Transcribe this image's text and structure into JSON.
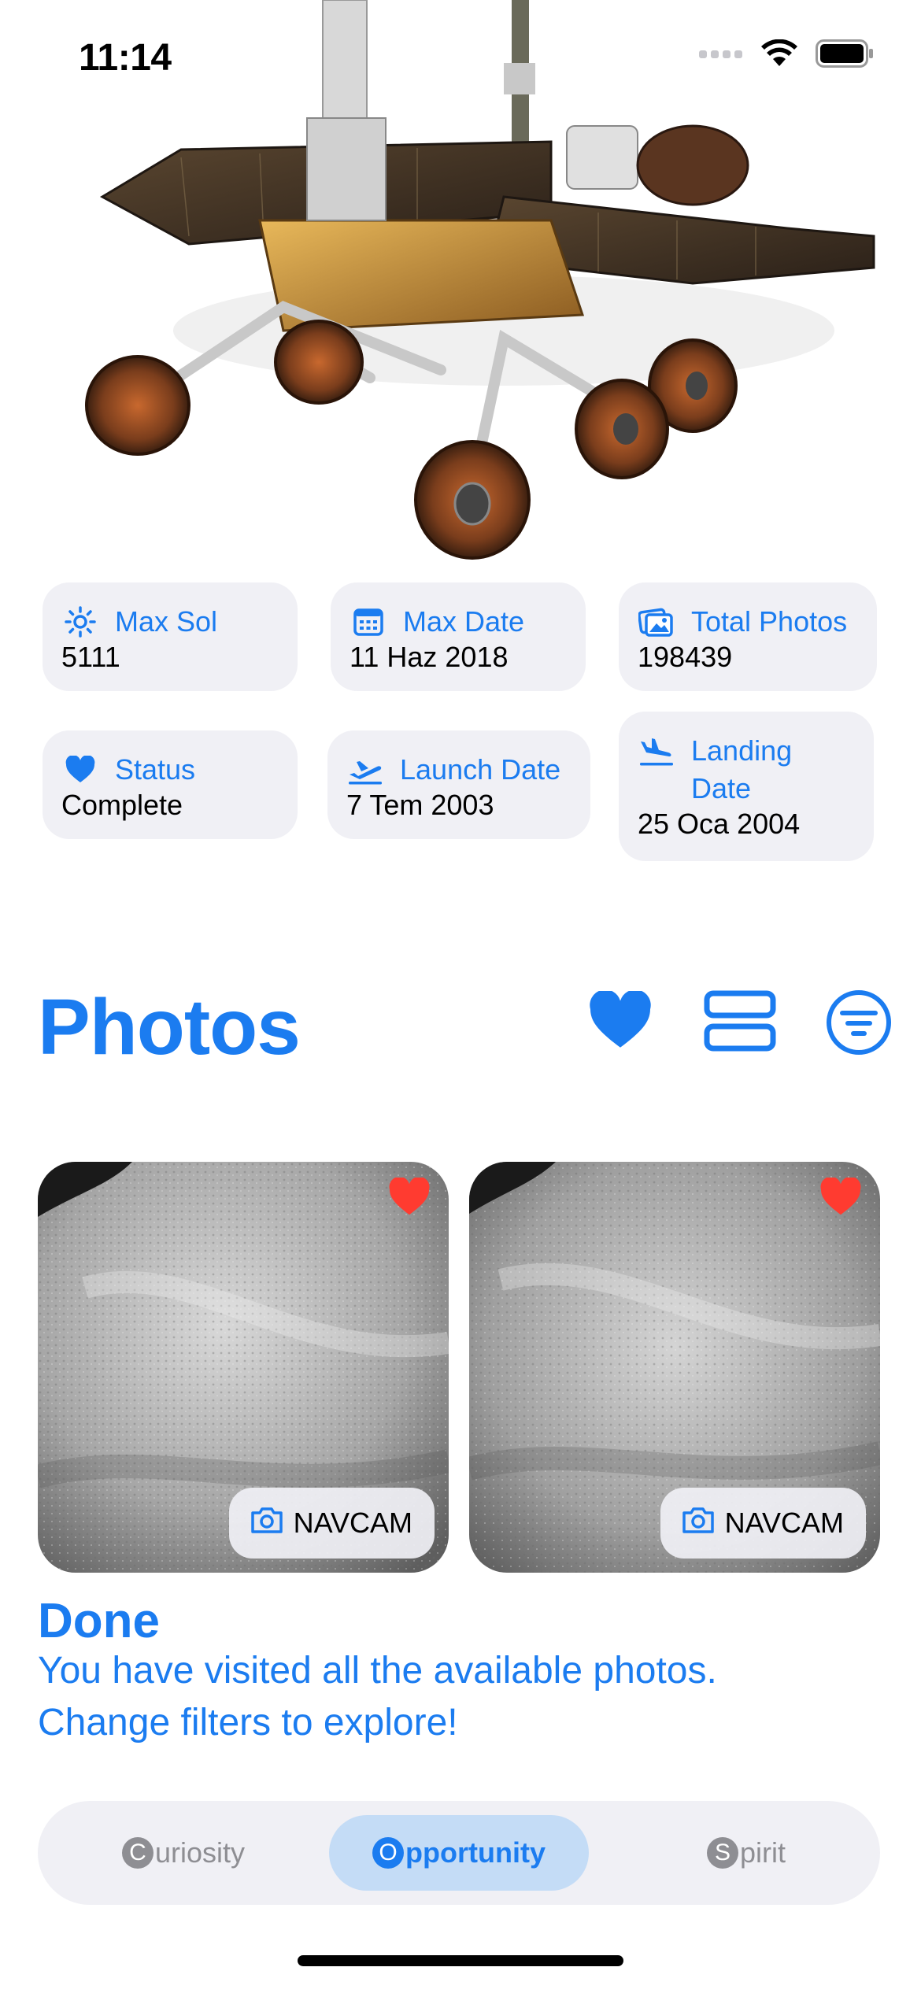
{
  "status_bar": {
    "time": "11:14"
  },
  "stats": {
    "max_sol": {
      "label": "Max Sol",
      "value": "5111"
    },
    "max_date": {
      "label": "Max Date",
      "value": "11 Haz 2018"
    },
    "total_photos": {
      "label": "Total Photos",
      "value": "198439"
    },
    "status": {
      "label": "Status",
      "value": "Complete"
    },
    "launch_date": {
      "label": "Launch Date",
      "value": "7 Tem 2003"
    },
    "landing_date": {
      "label_line1": "Landing",
      "label_line2": "Date",
      "value": "25 Oca 2004"
    }
  },
  "photos": {
    "title": "Photos",
    "items": [
      {
        "camera": "NAVCAM",
        "favorite": true
      },
      {
        "camera": "NAVCAM",
        "favorite": true
      }
    ]
  },
  "done": {
    "title": "Done",
    "line1": "You have visited all the available photos.",
    "line2": "Change filters to explore!"
  },
  "rover_picker": {
    "selected": "Opportunity",
    "items": [
      {
        "initial": "C",
        "rest": "uriosity"
      },
      {
        "initial": "O",
        "rest": "pportunity"
      },
      {
        "initial": "S",
        "rest": "pirit"
      }
    ]
  },
  "icons": {
    "max_sol": "sun-icon",
    "max_date": "calendar-icon",
    "total_photos": "photos-icon",
    "status": "heart-icon",
    "launch_date": "airplane-takeoff-icon",
    "landing_date": "airplane-landing-icon",
    "favorites": "heart-icon",
    "layout": "list-layout-icon",
    "filter": "filter-icon",
    "camera": "camera-icon"
  },
  "colors": {
    "accent": "#1b7cf0",
    "card_bg": "#f0f0f5",
    "favorite": "#ff3b30",
    "segment_active": "#c4dcf6"
  }
}
